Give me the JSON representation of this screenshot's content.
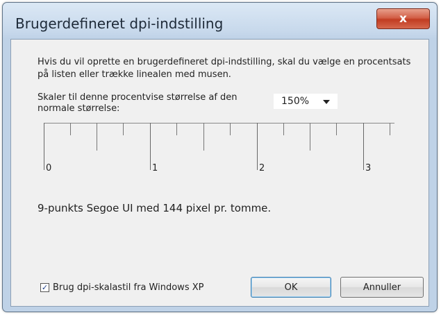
{
  "window": {
    "title": "Brugerdefineret dpi-indstilling",
    "close_label": "x"
  },
  "dialog": {
    "description": "Hvis du vil oprette en brugerdefineret dpi-indstilling, skal du vælge en procentsats på listen eller trække linealen med musen.",
    "scale_label": "Skaler til denne procentvise størrelse af den normale størrelse:",
    "scale_value": "150%",
    "ruler": {
      "labels": [
        "0",
        "1",
        "2",
        "3"
      ]
    },
    "font_info": "9-punkts Segoe UI med 144 pixel pr. tomme.",
    "checkbox_label": "Brug dpi-skalastil fra Windows XP",
    "checkbox_checked": true,
    "ok_label": "OK",
    "cancel_label": "Annuller"
  },
  "colors": {
    "close_button": "#c94a2f",
    "frame": "#c8d9ec"
  }
}
